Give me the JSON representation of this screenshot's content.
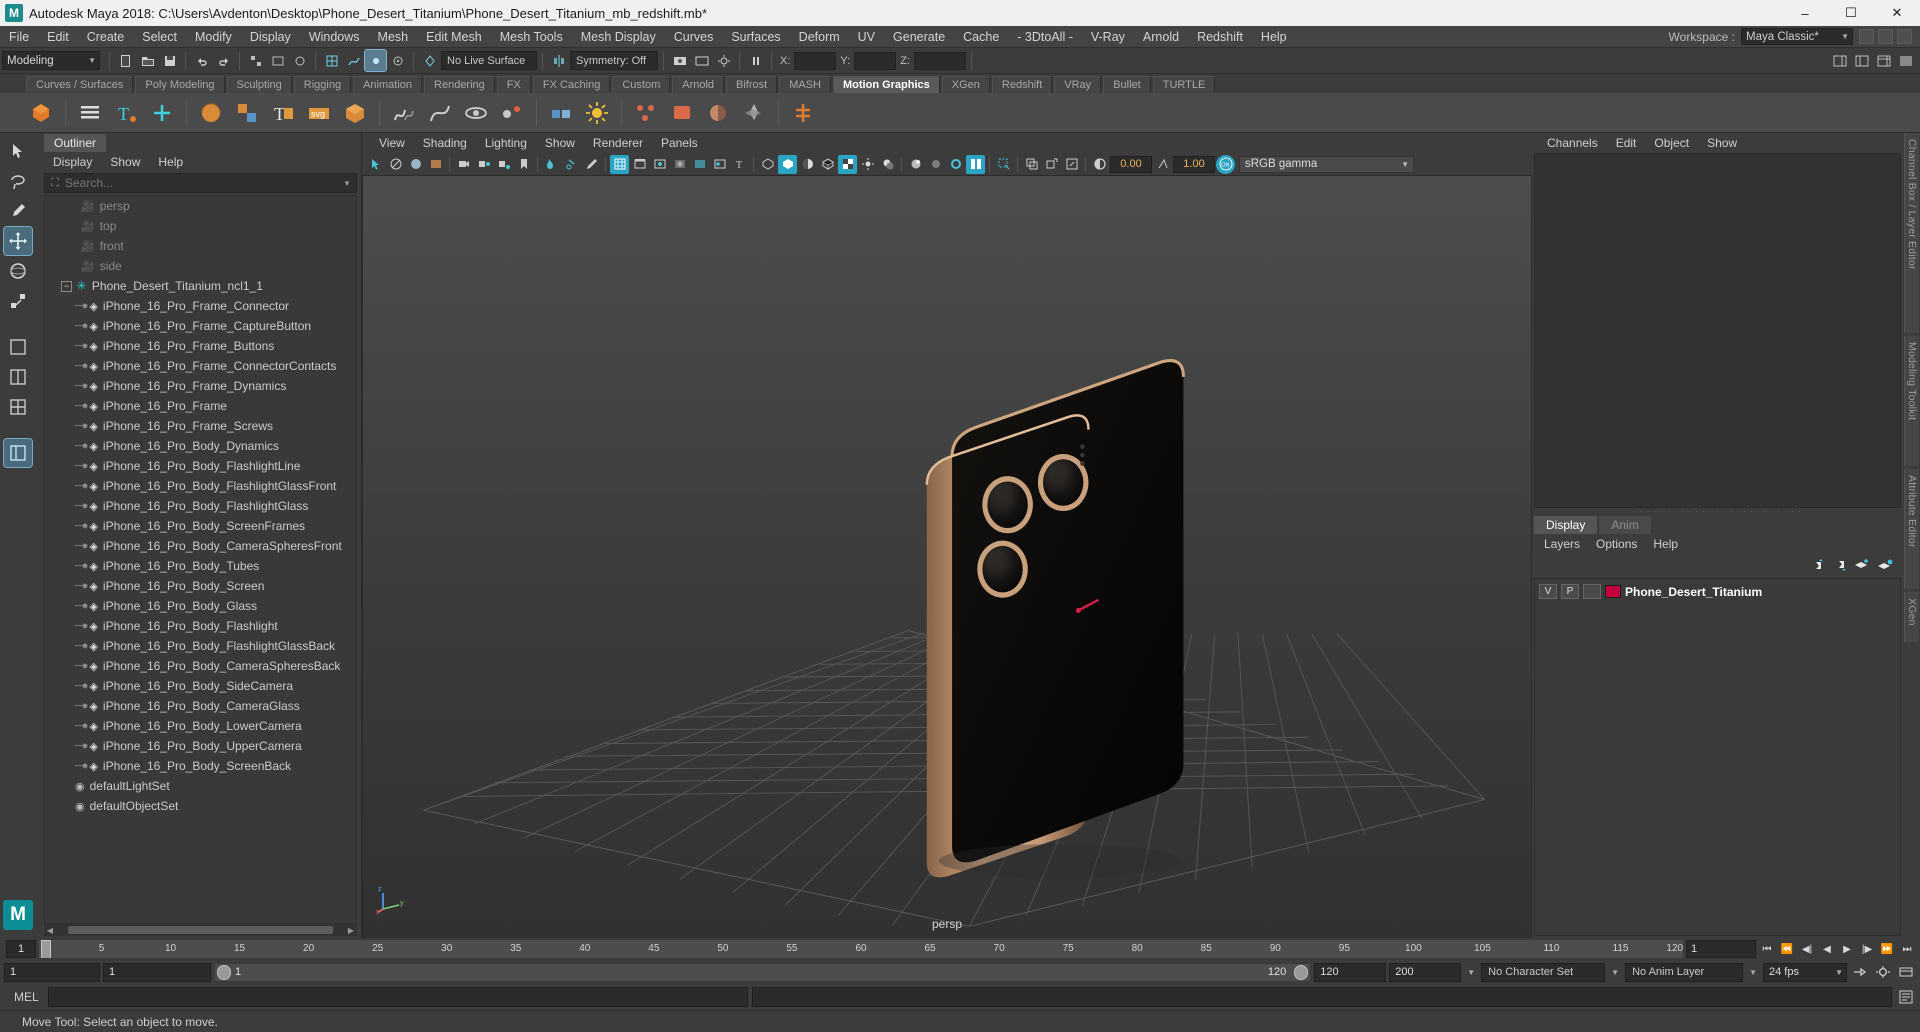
{
  "titlebar": {
    "icon": "maya-logo-icon",
    "text": "Autodesk Maya 2018: C:\\Users\\Avdenton\\Desktop\\Phone_Desert_Titanium\\Phone_Desert_Titanium_mb_redshift.mb*",
    "minimize": "–",
    "maximize": "☐",
    "close": "✕"
  },
  "menubar": {
    "items": [
      "File",
      "Edit",
      "Create",
      "Select",
      "Modify",
      "Display",
      "Windows",
      "Mesh",
      "Edit Mesh",
      "Mesh Tools",
      "Mesh Display",
      "Curves",
      "Surfaces",
      "Deform",
      "UV",
      "Generate",
      "Cache",
      "- 3DtoAll -",
      "V-Ray",
      "Arnold",
      "Redshift",
      "Help"
    ],
    "workspace_label": "Workspace :",
    "workspace_value": "Maya Classic*"
  },
  "statusline": {
    "mode_value": "Modeling",
    "no_live_surface": "No Live Surface",
    "symmetry": "Symmetry: Off",
    "coord_x_label": "X:",
    "coord_y_label": "Y:",
    "coord_z_label": "Z:",
    "coord_x_value": "",
    "coord_y_value": "",
    "coord_z_value": ""
  },
  "shelf": {
    "tabs": [
      "Curves / Surfaces",
      "Poly Modeling",
      "Sculpting",
      "Rigging",
      "Animation",
      "Rendering",
      "FX",
      "FX Caching",
      "Custom",
      "Arnold",
      "Bifrost",
      "MASH",
      "Motion Graphics",
      "XGen",
      "Redshift",
      "VRay",
      "Bullet",
      "TURTLE"
    ],
    "active_tab": "Motion Graphics",
    "icons": [
      "mash-network-icon",
      "mash-menu-icon",
      "mash-text-icon",
      "mash-trails-icon",
      "mash-cache-icon",
      "mash-dynamics-icon",
      "mash-type-icon",
      "mash-svg-icon",
      "mash-assets-icon",
      "mash-curve-icon",
      "mash-signal-icon",
      "mash-orbit-icon",
      "mash-spring-icon",
      "mash-color-icon",
      "mash-sun-icon",
      "mash-repro-icon",
      "mash-merge-icon",
      "mash-placer-icon",
      "mash-random-icon",
      "mash-influence-icon"
    ]
  },
  "toolbox": {
    "tools": [
      "select-tool",
      "lasso-select-tool",
      "paint-select-tool",
      "move-tool",
      "rotate-tool",
      "scale-tool",
      "last-tool",
      "single-pane-layout-icon",
      "two-pane-layout-icon",
      "three-pane-layout-icon",
      "four-pane-layout-icon"
    ],
    "logo": "M"
  },
  "outliner": {
    "tab": "Outliner",
    "menu": [
      "Display",
      "Show",
      "Help"
    ],
    "search_placeholder": "Search...",
    "search_value": "",
    "search_icon": "search-icon",
    "cameras": [
      "persp",
      "top",
      "front",
      "side"
    ],
    "group": "Phone_Desert_Titanium_ncl1_1",
    "children": [
      "iPhone_16_Pro_Frame_Connector",
      "iPhone_16_Pro_Frame_CaptureButton",
      "iPhone_16_Pro_Frame_Buttons",
      "iPhone_16_Pro_Frame_ConnectorContacts",
      "iPhone_16_Pro_Frame_Dynamics",
      "iPhone_16_Pro_Frame",
      "iPhone_16_Pro_Frame_Screws",
      "iPhone_16_Pro_Body_Dynamics",
      "iPhone_16_Pro_Body_FlashlightLine",
      "iPhone_16_Pro_Body_FlashlightGlassFront",
      "iPhone_16_Pro_Body_FlashlightGlass",
      "iPhone_16_Pro_Body_ScreenFrames",
      "iPhone_16_Pro_Body_CameraSpheresFront",
      "iPhone_16_Pro_Body_Tubes",
      "iPhone_16_Pro_Body_Screen",
      "iPhone_16_Pro_Body_Glass",
      "iPhone_16_Pro_Body_Flashlight",
      "iPhone_16_Pro_Body_FlashlightGlassBack",
      "iPhone_16_Pro_Body_CameraSpheresBack",
      "iPhone_16_Pro_Body_SideCamera",
      "iPhone_16_Pro_Body_CameraGlass",
      "iPhone_16_Pro_Body_LowerCamera",
      "iPhone_16_Pro_Body_UpperCamera",
      "iPhone_16_Pro_Body_ScreenBack"
    ],
    "sets": [
      "defaultLightSet",
      "defaultObjectSet"
    ]
  },
  "viewport": {
    "menu": [
      "View",
      "Shading",
      "Lighting",
      "Show",
      "Renderer",
      "Panels"
    ],
    "exposure_value": "0.00",
    "gamma_value": "1.00",
    "color_management": "sRGB gamma",
    "camera_label": "persp",
    "axis_labels": {
      "x": "x",
      "y": "y",
      "z": "z"
    }
  },
  "channelbox": {
    "menu": [
      "Channels",
      "Edit",
      "Object",
      "Show"
    ]
  },
  "layereditor": {
    "tabs": [
      "Display",
      "Anim"
    ],
    "active_tab": "Display",
    "menu": [
      "Layers",
      "Options",
      "Help"
    ],
    "buttons": [
      "move-layer-up-icon",
      "move-layer-down-icon",
      "new-layer-icon",
      "new-layer-from-selected-icon"
    ],
    "rows": [
      {
        "visibility": "V",
        "playback": "P",
        "display_type": "",
        "color": "#c4003c",
        "name": "Phone_Desert_Titanium"
      }
    ]
  },
  "sidetabs": [
    "Channel Box / Layer Editor",
    "Modeling Toolkit",
    "Attribute Editor",
    "XGen"
  ],
  "timeslider": {
    "current_frame": "1",
    "ticks": [
      "5",
      "10",
      "15",
      "20",
      "25",
      "30",
      "35",
      "40",
      "45",
      "50",
      "55",
      "60",
      "65",
      "70",
      "75",
      "80",
      "85",
      "90",
      "95",
      "100",
      "105",
      "110",
      "115",
      "120"
    ],
    "range_field": "1",
    "playback_buttons": [
      "go-to-start-icon",
      "step-back-key-icon",
      "step-back-frame-icon",
      "play-backwards-icon",
      "play-forwards-icon",
      "step-forward-frame-icon",
      "step-forward-key-icon",
      "go-to-end-icon"
    ]
  },
  "rangebar": {
    "anim_start": "1",
    "range_start": "1",
    "slider_left_label": "1",
    "slider_right_label": "120",
    "range_end": "120",
    "anim_end": "200",
    "character_set": "No Character Set",
    "anim_layer": "No Anim Layer",
    "fps": "24 fps",
    "icons": [
      "auto-key-icon",
      "animation-preferences-icon",
      "cycle-icon"
    ]
  },
  "melbar": {
    "label": "MEL",
    "input_value": "",
    "icon": "script-editor-icon"
  },
  "statusbar": {
    "message": "Move Tool: Select an object to move."
  },
  "colors": {
    "accent_cyan": "#2aa5c4",
    "layer_red": "#c4003c",
    "phone_gold": "#c79b78",
    "phone_black": "#0c0c0c",
    "title_bg": "#f0f0f0"
  }
}
